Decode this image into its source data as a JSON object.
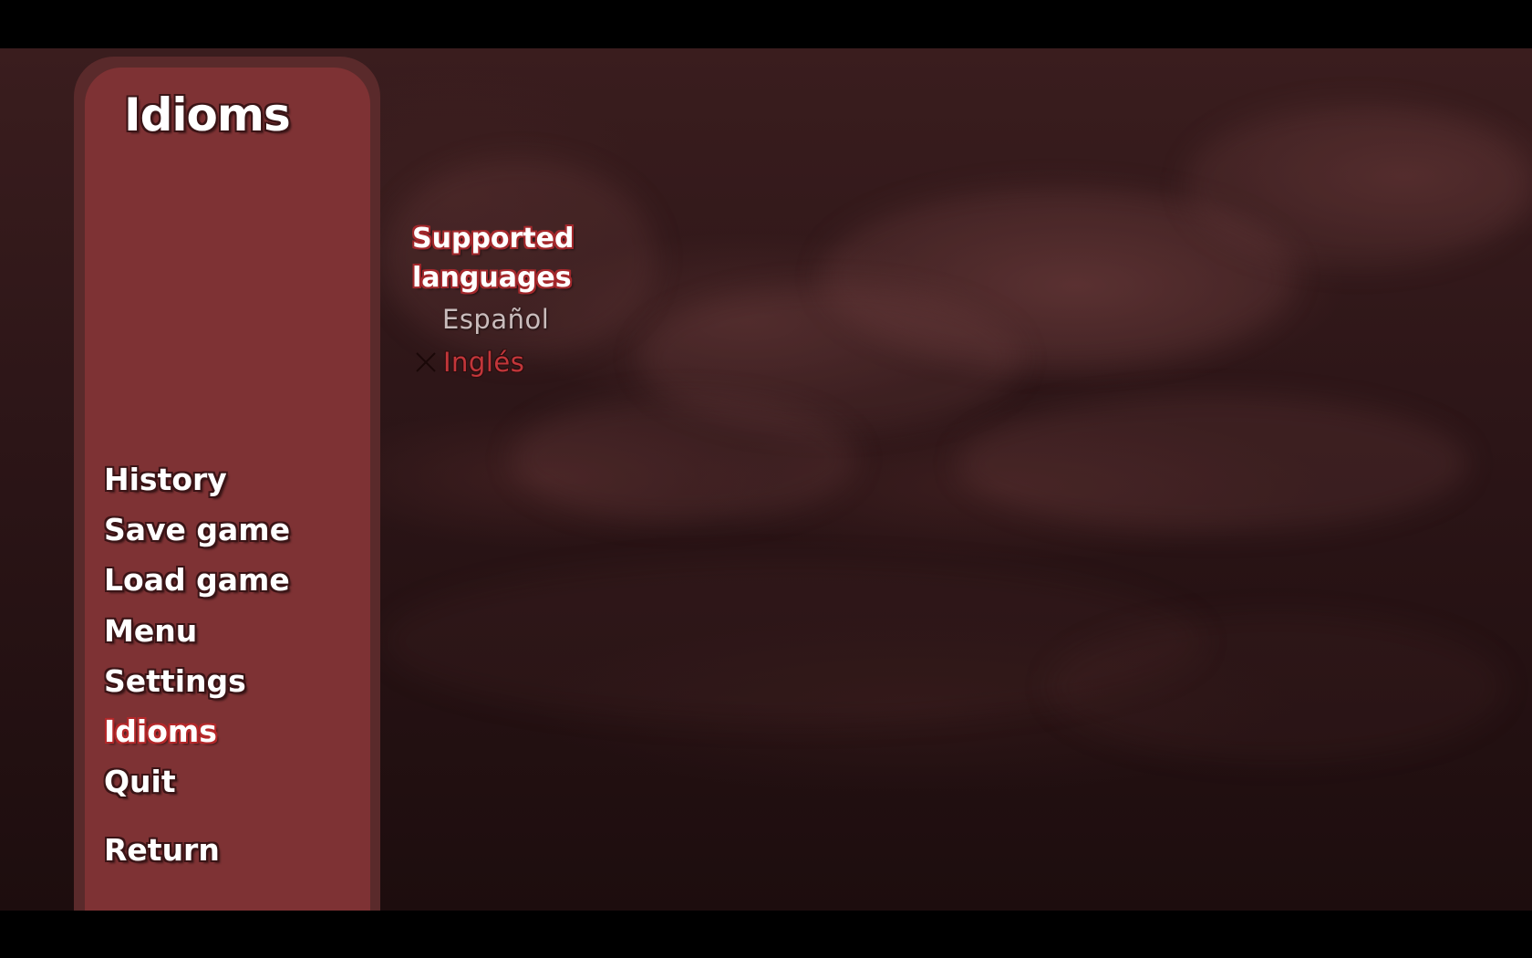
{
  "screen": {
    "title": "Idioms"
  },
  "nav": {
    "items": [
      {
        "label": "History",
        "active": false
      },
      {
        "label": "Save game",
        "active": false
      },
      {
        "label": "Load game",
        "active": false
      },
      {
        "label": "Menu",
        "active": false
      },
      {
        "label": "Settings",
        "active": false
      },
      {
        "label": "Idioms",
        "active": true
      },
      {
        "label": "Quit",
        "active": false
      }
    ],
    "return_label": "Return"
  },
  "languages": {
    "heading_line1": "Supported",
    "heading_line2": "languages",
    "options": [
      {
        "label": "Español",
        "selected": false
      },
      {
        "label": "Inglés",
        "selected": true
      }
    ],
    "selected_icon": "check-x-icon"
  },
  "colors": {
    "panel": "#7e3234",
    "panel_border": "#5a2a2b",
    "active_accent": "#b5282a",
    "selected_option": "#c2363a",
    "unselected_option": "#c9bcbc",
    "background": "#2c1517"
  }
}
